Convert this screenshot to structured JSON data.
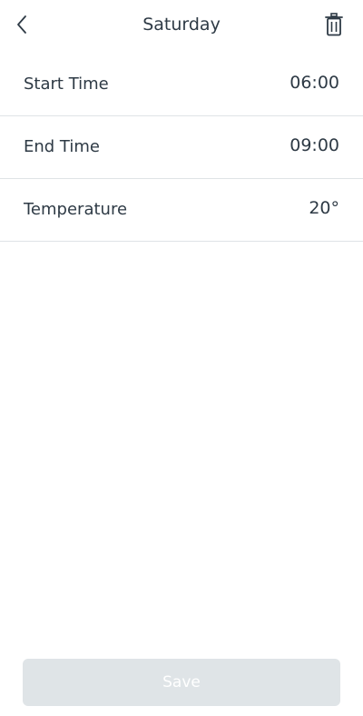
{
  "header": {
    "title": "Saturday",
    "back_icon": "chevron-left-icon",
    "delete_icon": "trash-icon"
  },
  "rows": [
    {
      "label": "Start Time",
      "value": "06:00"
    },
    {
      "label": "End Time",
      "value": "09:00"
    },
    {
      "label": "Temperature",
      "value": "20°"
    }
  ],
  "footer": {
    "save_label": "Save",
    "save_disabled": true
  },
  "colors": {
    "text": "#2e3a45",
    "divider": "#dfe3e6",
    "disabled_button_bg": "#dfe4e7",
    "disabled_button_text": "#ffffff"
  }
}
